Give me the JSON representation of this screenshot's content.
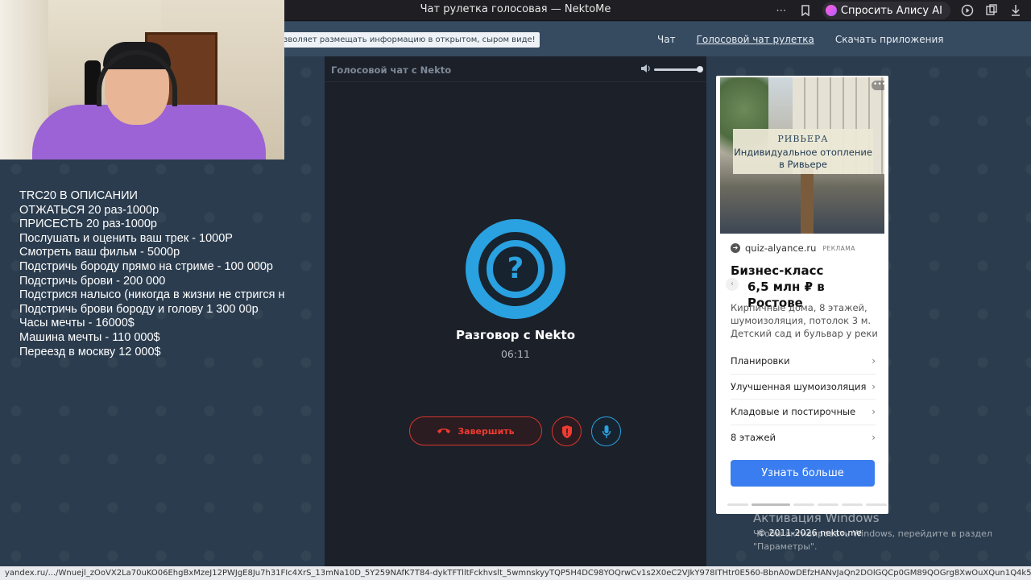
{
  "browser": {
    "tab_title": "Чат рулетка голосовая — NektoMe",
    "alisa_label": "Спросить Алису AI",
    "icons": [
      "more-icon",
      "bookmark-icon",
      "screen-icon",
      "collections-icon",
      "download-icon"
    ]
  },
  "header": {
    "notice": "зволяет размещать информацию в открытом, сыром виде!",
    "nav": [
      {
        "label": "Чат"
      },
      {
        "label": "Голосовой чат рулетка"
      },
      {
        "label": "Скачать приложения"
      }
    ]
  },
  "stream_overlay": {
    "lines": [
      "TRC20 В ОПИСАНИИ",
      "ОТЖАТЬСЯ 20 раз-1000р",
      "ПРИСЕСТЬ 20 раз-1000р",
      "Послушать и оценить ваш трек - 1000Р",
      "Смотреть ваш фильм - 5000р",
      "Подстричь бороду прямо на стриме - 100 000р",
      "Подстричь брови - 200 000",
      "Подстрися налысо (никогда в жизни не стригся н",
      "Подстричь брови бороду и голову 1 300 00р",
      "Часы мечты - 16000$",
      "Машина мечты - 110 000$",
      "Переезд в москву 12 000$"
    ]
  },
  "chat": {
    "panel_title": "Голосовой чат с Nekto",
    "conversation_title": "Разговор с Nekto",
    "timer": "06:11",
    "end_button": "Завершить",
    "accent_color": "#2aa1e0",
    "danger_color": "#ef3b32"
  },
  "ad": {
    "brand": "РИВЬЕРА",
    "slogan": "Индивидуальное отопление в Ривьере",
    "domain": "quiz-alyance.ru",
    "ad_label": "РЕКЛАМА",
    "headline_1": "Бизнес-класс",
    "headline_2": "6,5 млн ₽ в Ростове",
    "description": "Кирпичные дома, 8 этажей, шумоизоляция, потолок 3 м. Детский сад и бульвар у реки",
    "list": [
      {
        "label": "Планировки"
      },
      {
        "label": "Улучшенная шумоизоляция"
      },
      {
        "label": "Кладовые и постирочные"
      },
      {
        "label": "8 этажей"
      }
    ],
    "cta": "Узнать больше"
  },
  "windows_activation": {
    "title": "Активация Windows",
    "subtitle": "Чтобы активировать Windows, перейдите в раздел \"Параметры\"."
  },
  "footer": {
    "copyright": "© 2011-2026 nekto.me"
  },
  "status_url": "yandex.ru/.../Wnuejl_zOoVX2La70uKO06EhgBxMzeJ12PWJgE8Ju7h31FIc4XrS_13mNa10D_5Y259NAfK7T84-dykTFTlltFckhvslt_5wmnskyyTQP5H4DC98YOQrwCv1s2X0eC2VJkY978ITHtr0E560-BbnA0wDEfzHANvJaQn2DOlGQCp0GM89QOGrg8XwOuXQun1Q4k5f1qpPNC5aaOZ..."
}
